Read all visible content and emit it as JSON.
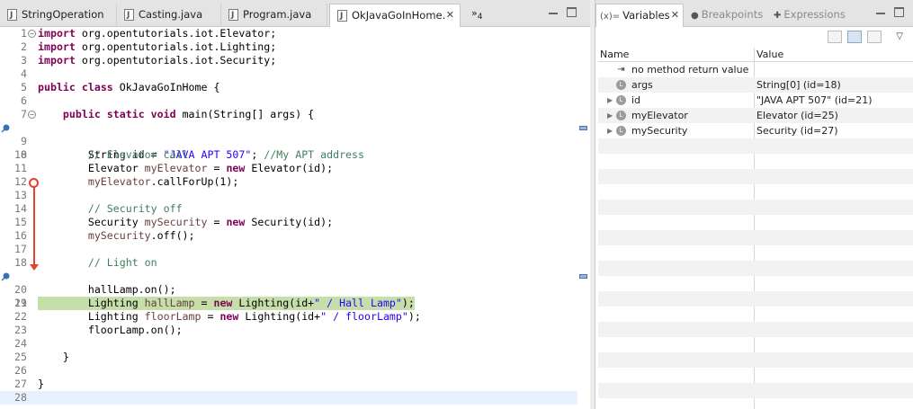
{
  "editor": {
    "tabs": [
      {
        "label": "StringOperation",
        "icon": "java-file-icon"
      },
      {
        "label": "Casting.java",
        "icon": "java-file-icon"
      },
      {
        "label": "Program.java",
        "icon": "java-file-icon"
      },
      {
        "label": "OkJavaGoInHome.",
        "icon": "java-file-icon",
        "active": true
      }
    ],
    "overflow_label": "»",
    "overflow_count": "4",
    "lines": [
      "1",
      "2",
      "3",
      "4",
      "5",
      "6",
      "7",
      "8",
      "9",
      "10",
      "11",
      "12",
      "13",
      "14",
      "15",
      "16",
      "17",
      "18",
      "19",
      "20",
      "21",
      "22",
      "23",
      "24",
      "25",
      "26",
      "27",
      "28"
    ],
    "code": {
      "l1_kw": "import",
      "l1_rest": " org.opentutorials.iot.Elevator;",
      "l2_kw": "import",
      "l2_rest": " org.opentutorials.iot.Lighting;",
      "l3_kw": "import",
      "l3_rest": " org.opentutorials.iot.Security;",
      "l5_kw1": "public",
      "l5_kw2": "class",
      "l5_rest": " OkJavaGoInHome {",
      "l7_kw1": "public",
      "l7_kw2": "static",
      "l7_kw3": "void",
      "l7_rest": " main(String[] args) {",
      "l8_a": "String id = ",
      "l8_str": "\"JAVA APT 507\"",
      "l8_b": "; ",
      "l8_cm": "//My APT address",
      "l10_cm": "// Elevator call",
      "l11_a": "Elevator ",
      "l11_var": "myElevator",
      "l11_b": " = ",
      "l11_kw": "new",
      "l11_c": " Elevator(id);",
      "l12_var": "myElevator",
      "l12_rest": ".callForUp(1);",
      "l14_cm": "// Security off",
      "l15_a": "Security ",
      "l15_var": "mySecurity",
      "l15_b": " = ",
      "l15_kw": "new",
      "l15_c": " Security(id);",
      "l16_var": "mySecurity",
      "l16_rest": ".off();",
      "l18_cm": "// Light on",
      "l19_a": "Lighting ",
      "l19_var": "hallLamp",
      "l19_b": " = ",
      "l19_kw": "new",
      "l19_c": " Lighting(id+",
      "l19_str": "\" / Hall Lamp\"",
      "l19_d": ");",
      "l20": "hallLamp.on();",
      "l22_a": "Lighting ",
      "l22_var": "floorLamp",
      "l22_b": " = ",
      "l22_kw": "new",
      "l22_c": " Lighting(id+",
      "l22_str": "\" / floorLamp\"",
      "l22_d": ");",
      "l23": "floorLamp.on();",
      "l25": "}",
      "l27": "}"
    }
  },
  "variables": {
    "tabs": [
      {
        "label": "Variables",
        "icon": "variables-icon",
        "active": true
      },
      {
        "label": "Breakpoints",
        "icon": "breakpoints-icon"
      },
      {
        "label": "Expressions",
        "icon": "expressions-icon"
      }
    ],
    "tab_prefix": "(x)=",
    "columns": {
      "name": "Name",
      "value": "Value"
    },
    "rows": [
      {
        "name": "no method return value",
        "value": "",
        "expandable": false,
        "icon": "return-value-icon"
      },
      {
        "name": "args",
        "value": "String[0]  (id=18)",
        "expandable": false,
        "icon": "local-variable-icon"
      },
      {
        "name": "id",
        "value": "\"JAVA APT 507\" (id=21)",
        "expandable": true,
        "icon": "local-variable-icon"
      },
      {
        "name": "myElevator",
        "value": "Elevator  (id=25)",
        "expandable": true,
        "icon": "local-variable-icon"
      },
      {
        "name": "mySecurity",
        "value": "Security  (id=27)",
        "expandable": true,
        "icon": "local-variable-icon"
      }
    ]
  },
  "colors": {
    "keyword": "#7f0055",
    "string": "#2a00ff",
    "comment": "#3f7f5f",
    "local_var": "#6a3e3e",
    "current_line_highlight": "#c6dfaa",
    "step_arrow": "#e0422c"
  }
}
